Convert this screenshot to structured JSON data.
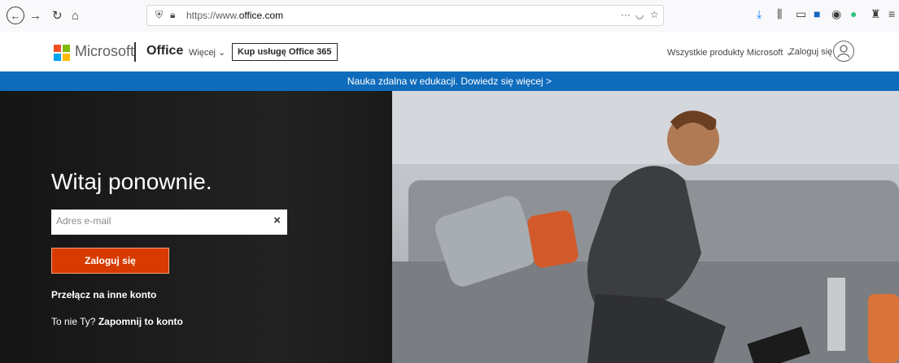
{
  "browser": {
    "url_prefix": "https://www.",
    "url_domain": "office.com",
    "icons": [
      "back-icon",
      "forward-icon",
      "reload-icon",
      "home-icon",
      "shield-icon",
      "lock-icon",
      "more-icon",
      "pocket-icon",
      "bookmark-star-icon",
      "download-icon",
      "library-icon",
      "sidebar-icon",
      "extension-icon",
      "privacy-icon",
      "check-icon",
      "gift-icon",
      "menu-icon"
    ]
  },
  "header": {
    "brand": "Microsoft",
    "office": "Office",
    "more": "Więcej ⌄",
    "buy_button": "Kup usługę Office 365",
    "all_products": "Wszystkie produkty Microsoft ⌄",
    "login": "Zaloguj się",
    "logo_colors": [
      "#f25022",
      "#7fba00",
      "#00a4ef",
      "#ffb900"
    ]
  },
  "banner": {
    "text": "Nauka zdalna w edukacji. Dowiedz się więcej >",
    "color": "#0f6cbd"
  },
  "hero": {
    "title": "Witaj ponownie.",
    "email_placeholder": "Adres e-mail",
    "login_button": "Zaloguj się",
    "switch_account": "Przełącz na inne konto",
    "not_you_prefix": "To nie Ty?",
    "forget_account": "Zapomnij to konto",
    "accent_color": "#d83b01"
  }
}
